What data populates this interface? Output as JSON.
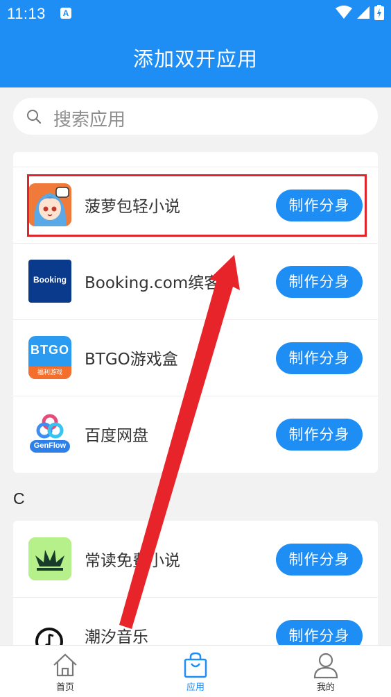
{
  "status_bar": {
    "time": "11:13",
    "notification_badge": "A"
  },
  "header": {
    "title": "添加双开应用"
  },
  "search": {
    "placeholder": "搜索应用"
  },
  "apps_b": [
    {
      "name": "菠萝包轻小说",
      "button": "制作分身",
      "icon": "boluobao-icon"
    },
    {
      "name": "Booking.com缤客",
      "button": "制作分身",
      "icon": "booking-icon",
      "icon_text": "Booking"
    },
    {
      "name": "BTGO游戏盒",
      "button": "制作分身",
      "icon": "btgo-icon",
      "icon_text": "BTGO",
      "icon_subtext": "福利游戏"
    },
    {
      "name": "百度网盘",
      "button": "制作分身",
      "icon": "baidu-netdisk-icon",
      "icon_text": "GenFlow"
    }
  ],
  "section_c": {
    "letter": "C"
  },
  "apps_c": [
    {
      "name": "常读免费小说",
      "button": "制作分身",
      "icon": "changdu-icon"
    },
    {
      "name": "潮汐音乐",
      "button": "制作分身",
      "icon": "chaoxi-music-icon"
    }
  ],
  "tabs": [
    {
      "label": "首页",
      "icon": "home-icon"
    },
    {
      "label": "应用",
      "icon": "shopping-bag-icon",
      "active": true
    },
    {
      "label": "我的",
      "icon": "user-icon"
    }
  ],
  "colors": {
    "primary": "#1e8ef5",
    "highlight": "#e0242b",
    "background": "#f2f2f2"
  }
}
